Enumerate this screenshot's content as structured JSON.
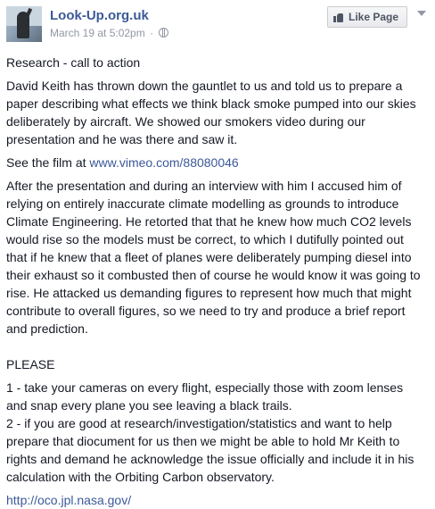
{
  "page": {
    "name": "Look-Up.org.uk",
    "timestamp": "March 19 at 5:02pm",
    "separator": "·",
    "like_button_label": "Like Page"
  },
  "icons": {
    "avatar": "page-avatar",
    "privacy": "globe-icon",
    "like": "thumb-icon",
    "menu": "chevron-down-icon"
  },
  "colors": {
    "link": "#3b5998",
    "text": "#141823",
    "meta": "#9197a3"
  },
  "post": {
    "heading": "Research - call to action",
    "para1": "David Keith has thrown down the gauntlet to us and told us to prepare a paper describing what effects we think black smoke pumped into our skies deliberately by aircraft. We showed our smokers video during our presentation and he was there and saw it.",
    "film_prefix": "See the film at ",
    "film_link": "www.vimeo.com/88080046",
    "para2": "After the presentation and during an interview with him I accused him of relying on entirely inaccurate climate modelling as grounds to introduce Climate Engineering. He retorted that that he knew how much CO2 levels would rise so the models must be correct, to which I dutifully pointed out that if he knew that a fleet of planes were deliberately pumping diesel into their exhaust so it combusted then of course he would know it was going to rise. He attacked us demanding figures to represent how much that might contribute to overall figures, so we need to try and produce a brief report and prediction.",
    "please": "PLEASE",
    "item1": "1 - take your cameras on every flight, especially those with zoom lenses and snap every plane you see leaving a black trails.",
    "item2": "2 - if you are good at research/investigation/statistics and want to help prepare that diocument for us then we might be able to hold Mr Keith to rights and demand he acknowledge the issue officially and include it in his calculation with the Orbiting Carbon observatory.",
    "oco_link": "http://oco.jpl.nasa.gov/"
  }
}
